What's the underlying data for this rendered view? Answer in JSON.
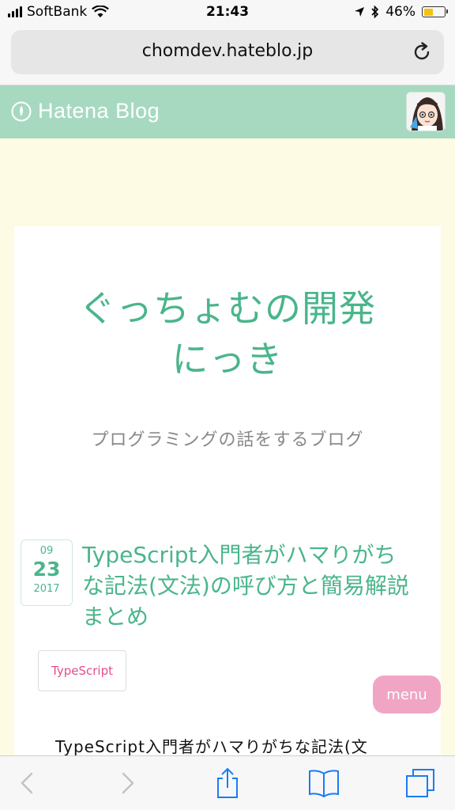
{
  "status_bar": {
    "carrier": "SoftBank",
    "time": "21:43",
    "battery": "46%",
    "battery_level": 0.46
  },
  "browser": {
    "url": "chomdev.hateblo.jp"
  },
  "header": {
    "logo_text": "Hatena Blog"
  },
  "blog": {
    "title_line1": "ぐっちょむの開発",
    "title_line2": "にっき",
    "description": "プログラミングの話をするブログ"
  },
  "entry": {
    "month": "09",
    "day": "23",
    "year": "2017",
    "title": "TypeScript入門者がハマりがちな記法(文法)の呼び方と簡易解説まとめ",
    "category": "TypeScript",
    "excerpt": "TypeScript入門者がハマりがちな記法(文"
  },
  "menu": {
    "label": "menu"
  },
  "colors": {
    "accent": "#4ab58b",
    "header_bg": "#a7d9c1",
    "page_bg": "#fdfbe3",
    "menu_bg": "#f1a5c4",
    "category_text": "#e24e8d",
    "toolbar_icon": "#1a7cf5"
  }
}
